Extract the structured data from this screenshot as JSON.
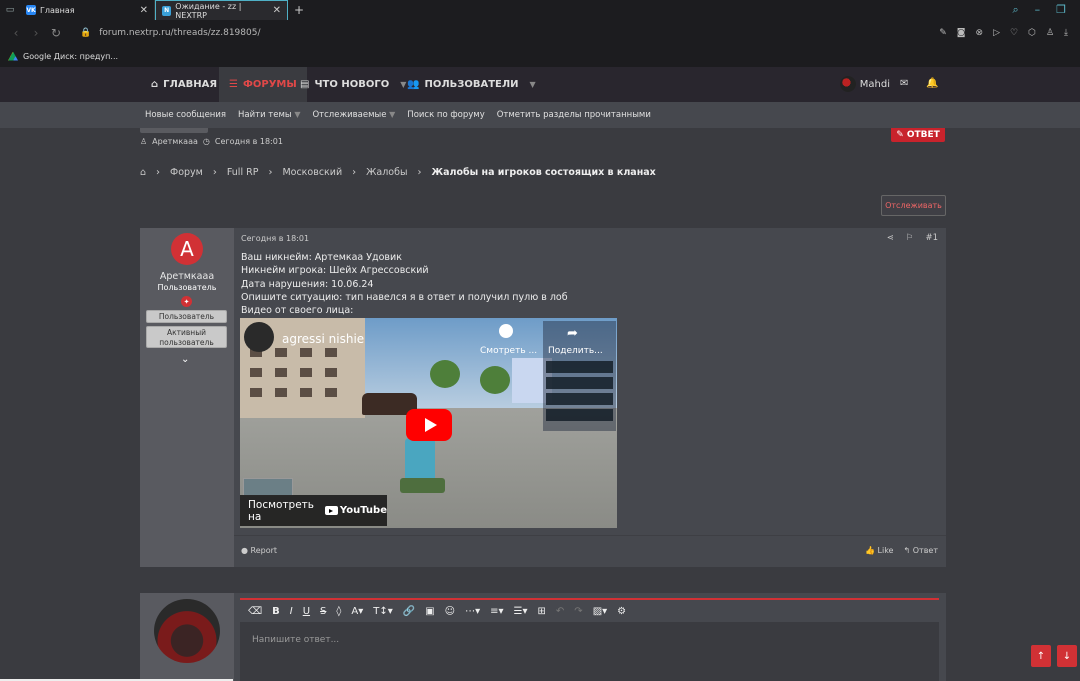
{
  "browser": {
    "tabs": [
      {
        "label": "Главная",
        "icon": "vk-icon"
      },
      {
        "label": "Ожидание - zz | NEXTRP",
        "icon": "nextrp-icon"
      }
    ],
    "url": "forum.nextrp.ru/threads/zz.819805/",
    "bookmark": "Google Диск: предуп..."
  },
  "nav": {
    "home": "ГЛАВНАЯ",
    "forums": "ФОРУМЫ",
    "whats_new": "ЧТО НОВОГО",
    "users": "ПОЛЬЗОВАТЕЛИ",
    "username": "Mahdi"
  },
  "subnav": {
    "new_posts": "Новые сообщения",
    "find_threads": "Найти темы",
    "watched": "Отслеживаемые",
    "search_forum": "Поиск по форуму",
    "mark_read": "Отметить разделы прочитанными"
  },
  "thread": {
    "author": "Аретмкааа",
    "time": "Сегодня в 18:01",
    "reply_button": "ОТВЕТ",
    "follow_button": "Отслеживать"
  },
  "breadcrumbs": {
    "forum": "Форум",
    "section": "Full RP",
    "server": "Московский",
    "complaints": "Жалобы",
    "current": "Жалобы на игроков состоящих в кланах"
  },
  "post": {
    "author": "Аретмкааа",
    "role": "Пользователь",
    "badge1": "Пользователь",
    "badge2": "Активный пользователь",
    "date": "Сегодня в 18:01",
    "number": "#1",
    "lines": [
      "Ваш никнейм: Артемкаа Удовик",
      "Никнейм игрока: Шейх Агрессовский",
      "Дата нарушения: 10.06.24",
      "Опишите ситуацию: тип навелся я в ответ и получил пулю в лоб",
      "Видео от своего лица:"
    ],
    "report": "Report",
    "like": "Like",
    "reply": "Ответ"
  },
  "video": {
    "title": "agressi nishie",
    "watch_later": "Смотреть ...",
    "share": "Поделить...",
    "watch_on": "Посмотреть на",
    "youtube": "YouTube"
  },
  "editor": {
    "placeholder": "Напишите ответ..."
  },
  "colors": {
    "accent": "#d13135",
    "nav_bg": "#29262e",
    "page_bg": "#3a3b40"
  }
}
